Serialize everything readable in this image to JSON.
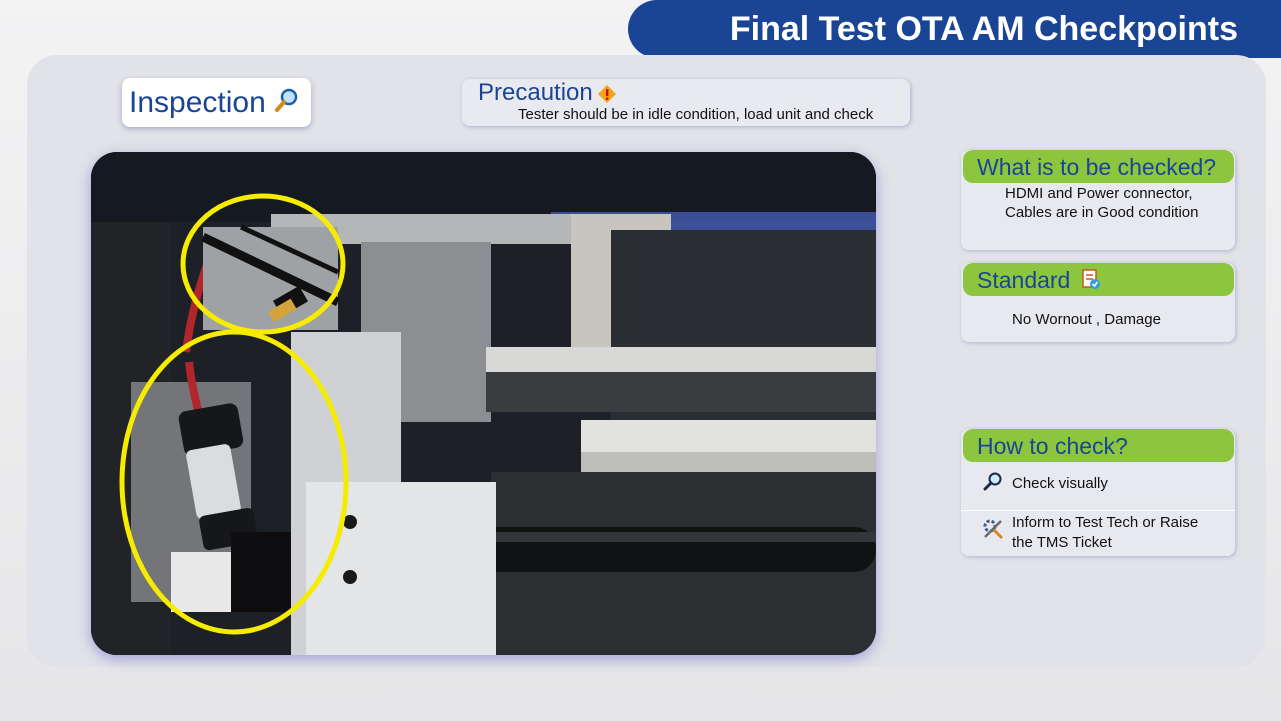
{
  "banner": {
    "title": "Final Test OTA AM Checkpoints"
  },
  "inspection": {
    "label": "Inspection",
    "icon": "magnifier-icon"
  },
  "precaution": {
    "title": "Precaution",
    "icon": "warning-icon",
    "text": "Tester should be in idle condition, load unit and check"
  },
  "photo": {
    "description_icons": [
      "hdmi-connector",
      "power-connector"
    ],
    "highlight_color": "#f5ec00"
  },
  "what_to_check": {
    "title": "What is to be checked?",
    "line1": "HDMI and Power connector,",
    "line2": "Cables are in Good condition"
  },
  "standard": {
    "title": "Standard",
    "icon": "checklist-icon",
    "text": "No Wornout , Damage"
  },
  "how_to_check": {
    "title": "How to check?",
    "step1": {
      "icon": "magnifier-icon",
      "text": "Check visually"
    },
    "step2": {
      "icon": "tools-icon",
      "line1": "Inform to Test Tech or Raise",
      "line2": "the TMS Ticket"
    }
  },
  "colors": {
    "banner": "#1a4494",
    "header_green": "#8cc63f",
    "title_blue": "#1a4494",
    "panel": "#e2e3e8"
  }
}
